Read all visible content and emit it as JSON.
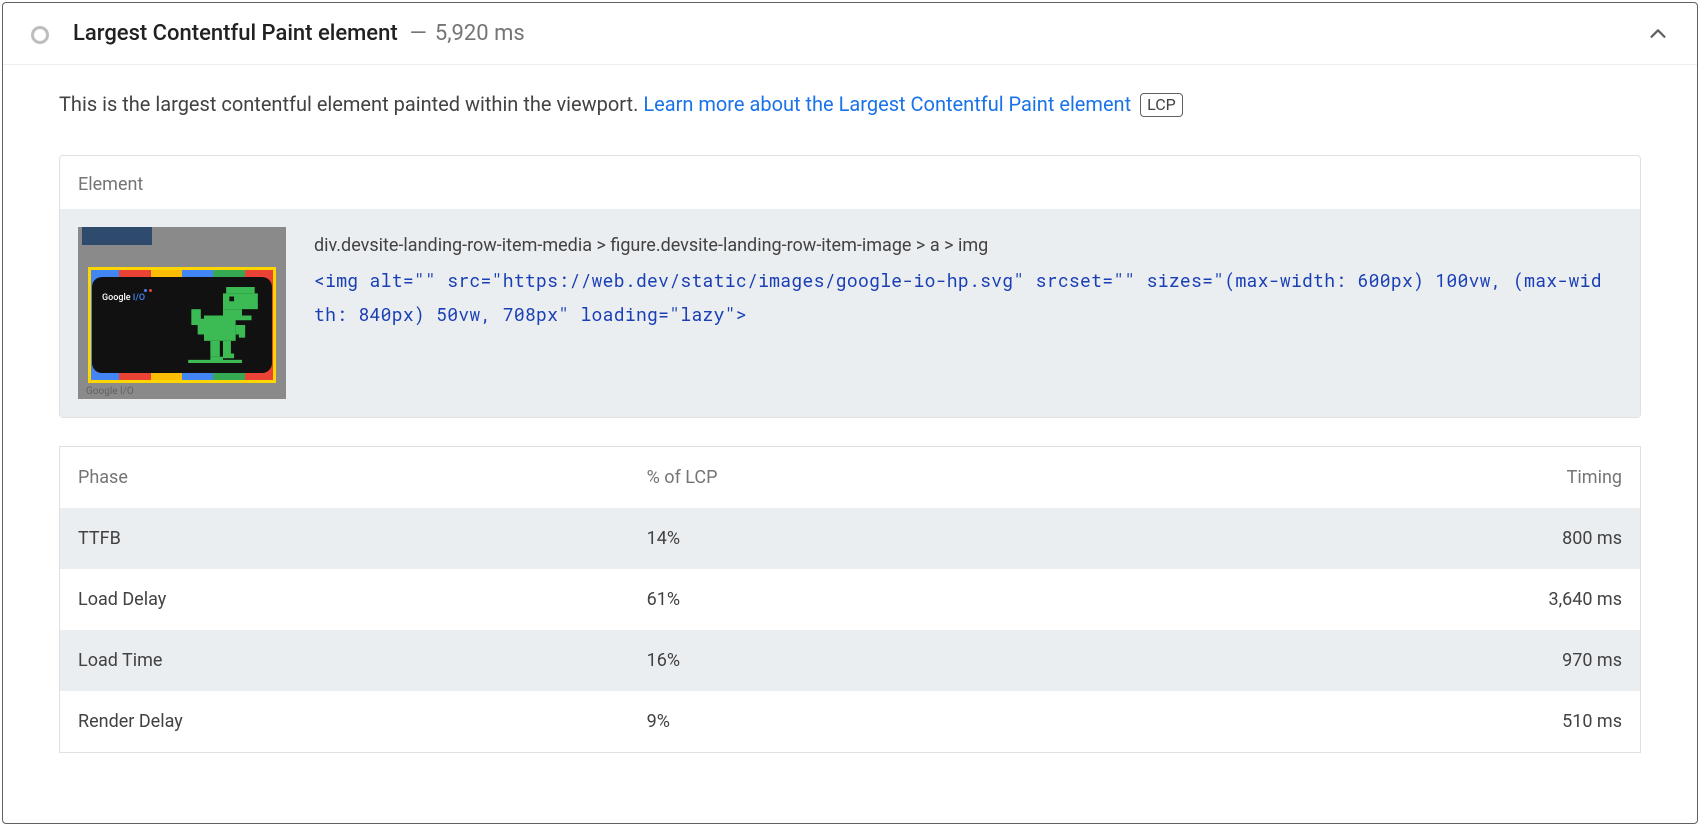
{
  "audit": {
    "title": "Largest Contentful Paint element",
    "dash": "—",
    "time": "5,920 ms",
    "description_prefix": "This is the largest contentful element painted within the viewport. ",
    "learn_more": "Learn more about the Largest Contentful Paint element",
    "badge": "LCP"
  },
  "element_card": {
    "heading": "Element",
    "thumb_brand": "Google",
    "thumb_brand_io": " I/O",
    "thumb_caption": "Google I/O",
    "selector": "div.devsite-landing-row-item-media > figure.devsite-landing-row-item-image > a > img",
    "markup": "<img alt=\"\" src=\"https://web.dev/static/images/google-io-hp.svg\" srcset=\"\" sizes=\"(max-width: 600px) 100vw, (max-width: 840px) 50vw, 708px\" loading=\"lazy\">"
  },
  "phase_table": {
    "headers": {
      "phase": "Phase",
      "pct": "% of LCP",
      "timing": "Timing"
    },
    "rows": [
      {
        "phase": "TTFB",
        "pct": "14%",
        "timing": "800 ms"
      },
      {
        "phase": "Load Delay",
        "pct": "61%",
        "timing": "3,640 ms"
      },
      {
        "phase": "Load Time",
        "pct": "16%",
        "timing": "970 ms"
      },
      {
        "phase": "Render Delay",
        "pct": "9%",
        "timing": "510 ms"
      }
    ]
  }
}
